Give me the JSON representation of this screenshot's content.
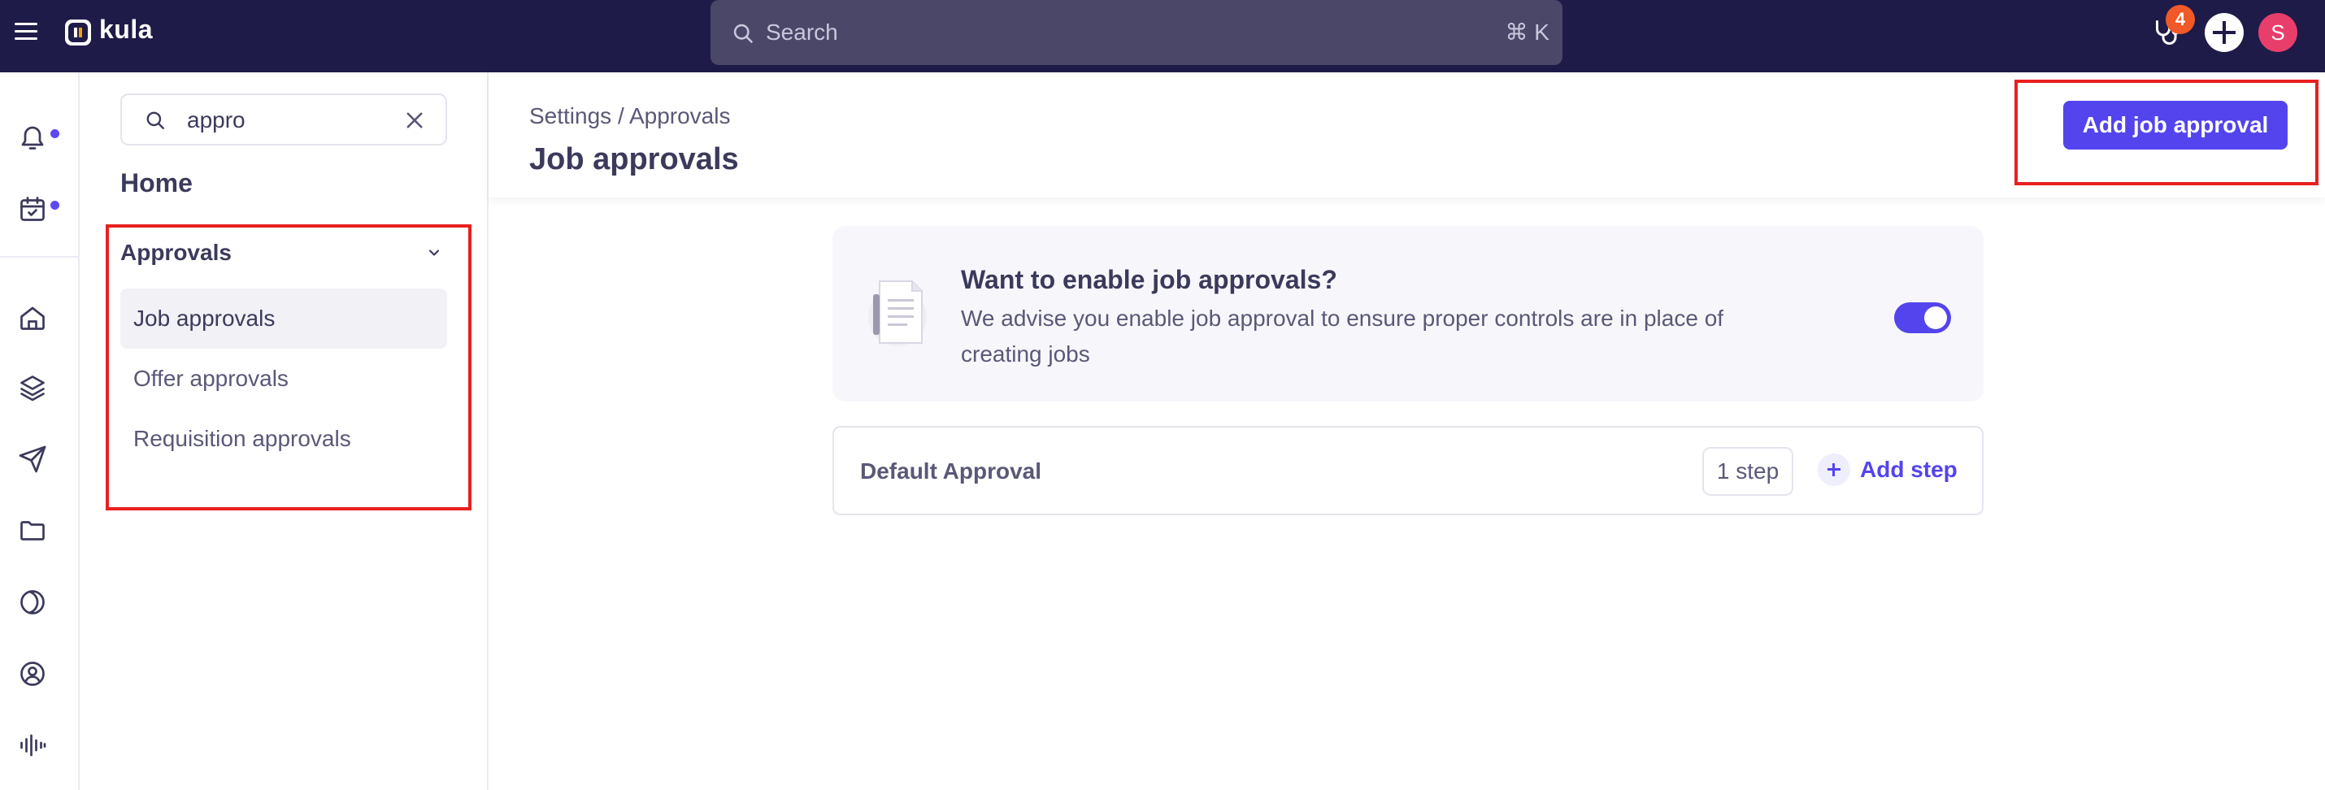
{
  "topbar": {
    "logo_text": "kula",
    "search_placeholder": "Search",
    "search_shortcut": "⌘ K",
    "notification_count": "4",
    "avatar_initial": "S"
  },
  "sidebar": {
    "search_value": "appro",
    "home_label": "Home",
    "group_label": "Approvals",
    "items": [
      {
        "label": "Job approvals",
        "active": true
      },
      {
        "label": "Offer approvals",
        "active": false
      },
      {
        "label": "Requisition approvals",
        "active": false
      }
    ]
  },
  "main": {
    "breadcrumb": {
      "parent": "Settings",
      "separator": " / ",
      "current": "Approvals"
    },
    "title": "Job approvals",
    "add_button_label": "Add job approval",
    "enable_card": {
      "title": "Want to enable job approvals?",
      "description": "We advise you enable job approval to ensure proper controls are in place of creating jobs",
      "toggle_on": true
    },
    "default_approval": {
      "name": "Default Approval",
      "steps": "1 step",
      "add_step_label": "Add step"
    }
  },
  "colors": {
    "topbar": "#1f1b48",
    "accent": "#5344ee",
    "highlight": "#e8201f",
    "badge": "#f05a28",
    "avatar": "#e83e6c"
  }
}
